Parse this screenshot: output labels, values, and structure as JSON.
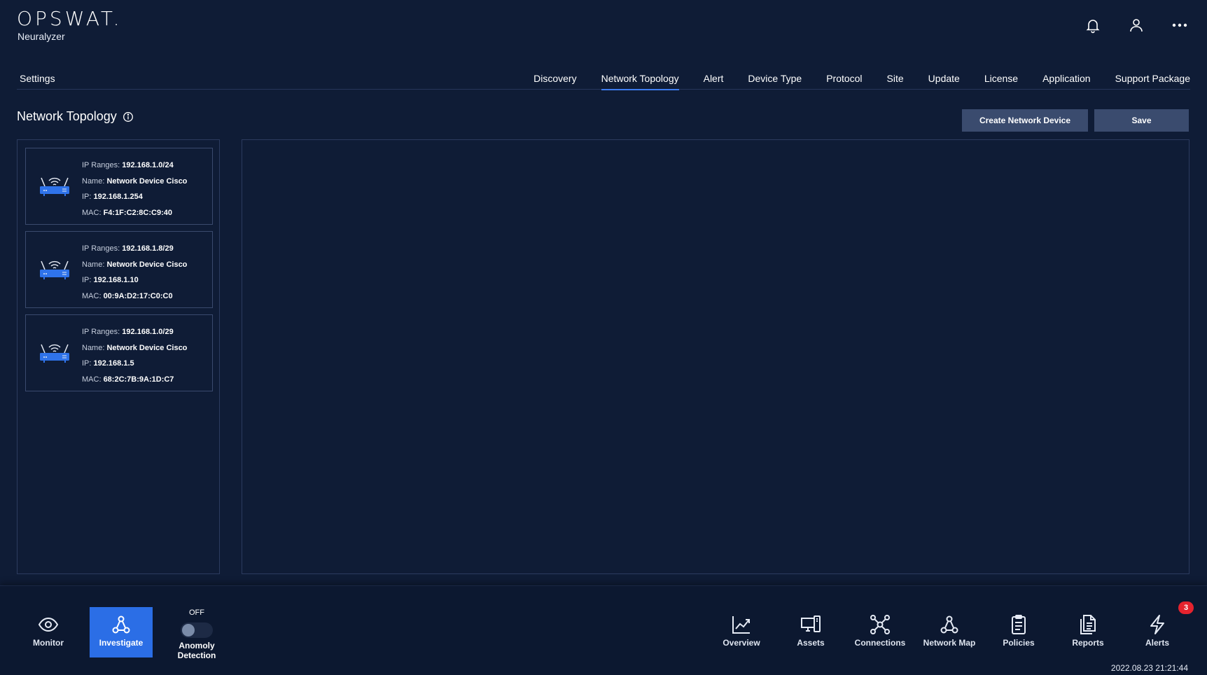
{
  "header": {
    "logo": "OPSWAT.",
    "product": "Neuralyzer",
    "icons": [
      "bell-icon",
      "user-icon",
      "more-icon"
    ]
  },
  "settings": {
    "title": "Settings",
    "tabs": [
      {
        "label": "Discovery",
        "active": false
      },
      {
        "label": "Network Topology",
        "active": true
      },
      {
        "label": "Alert",
        "active": false
      },
      {
        "label": "Device Type",
        "active": false
      },
      {
        "label": "Protocol",
        "active": false
      },
      {
        "label": "Site",
        "active": false
      },
      {
        "label": "Update",
        "active": false
      },
      {
        "label": "License",
        "active": false
      },
      {
        "label": "Application",
        "active": false
      },
      {
        "label": "Support Package",
        "active": false
      }
    ]
  },
  "page": {
    "title": "Network Topology",
    "create_button": "Create Network Device",
    "save_button": "Save"
  },
  "devices": [
    {
      "ip_ranges_label": "IP Ranges:",
      "ip_ranges": "192.168.1.0/24",
      "name_label": "Name:",
      "name": "Network Device Cisco",
      "ip_label": "IP:",
      "ip": "192.168.1.254",
      "mac_label": "MAC:",
      "mac": "F4:1F:C2:8C:C9:40"
    },
    {
      "ip_ranges_label": "IP Ranges:",
      "ip_ranges": "192.168.1.8/29",
      "name_label": "Name:",
      "name": "Network Device Cisco",
      "ip_label": "IP:",
      "ip": "192.168.1.10",
      "mac_label": "MAC:",
      "mac": "00:9A:D2:17:C0:C0"
    },
    {
      "ip_ranges_label": "IP Ranges:",
      "ip_ranges": "192.168.1.0/29",
      "name_label": "Name:",
      "name": "Network Device Cisco",
      "ip_label": "IP:",
      "ip": "192.168.1.5",
      "mac_label": "MAC:",
      "mac": "68:2C:7B:9A:1D:C7"
    }
  ],
  "bottom_nav": {
    "left": [
      {
        "label": "Monitor",
        "icon": "eye-icon",
        "active": false
      },
      {
        "label": "Investigate",
        "icon": "hierarchy-icon",
        "active": true
      }
    ],
    "anomaly": {
      "state": "OFF",
      "label": "Anomoly Detection"
    },
    "right": [
      {
        "label": "Overview",
        "icon": "chart-line-icon"
      },
      {
        "label": "Assets",
        "icon": "devices-icon"
      },
      {
        "label": "Connections",
        "icon": "network-icon"
      },
      {
        "label": "Network Map",
        "icon": "hierarchy-icon"
      },
      {
        "label": "Policies",
        "icon": "clipboard-icon"
      },
      {
        "label": "Reports",
        "icon": "documents-icon"
      },
      {
        "label": "Alerts",
        "icon": "bolt-icon"
      }
    ],
    "alerts_badge": "3",
    "timestamp": "2022.08.23 21:21:44"
  },
  "colors": {
    "background": "#0f1c36",
    "accent": "#2b6ee6",
    "device_icon": "#2f73ea",
    "badge": "#e5232e",
    "button": "#3a4b6e"
  }
}
